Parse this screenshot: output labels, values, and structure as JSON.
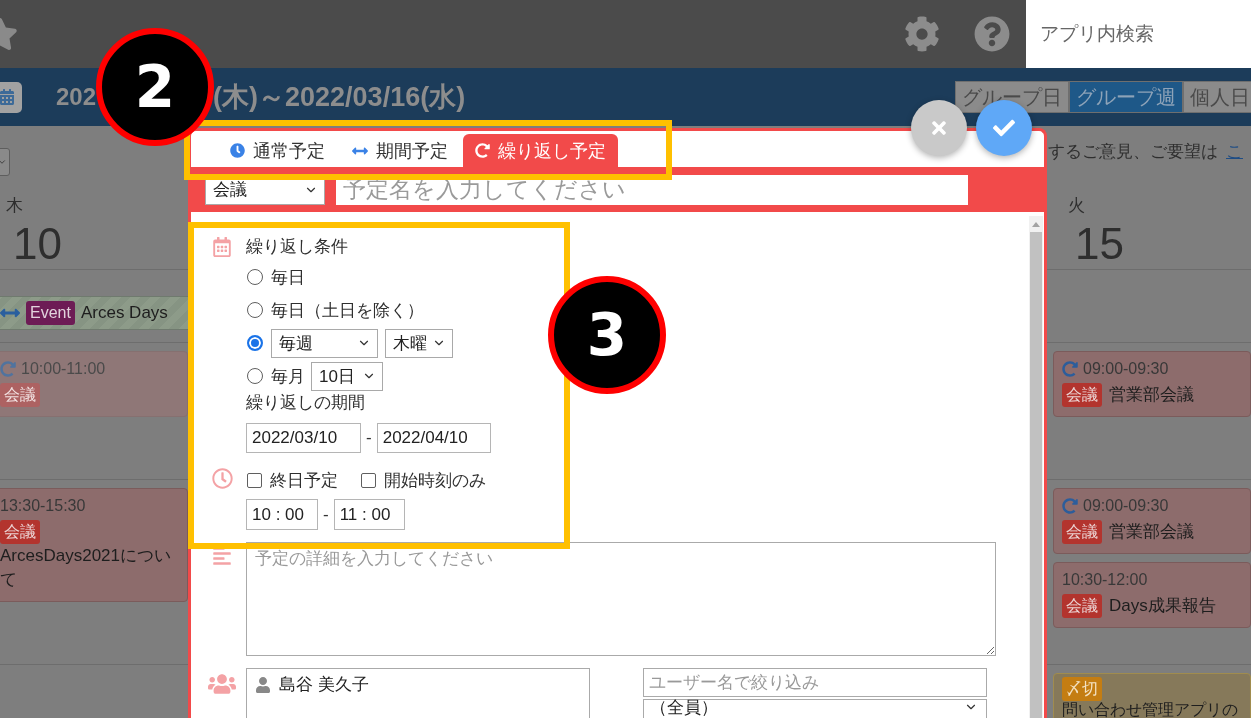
{
  "top_bar": {
    "search": {
      "placeholder": "アプリ内検索"
    }
  },
  "header": {
    "date_range_parts": [
      "202",
      "(木)～2022/03/16(水)"
    ],
    "view_tabs": [
      {
        "label": "グループ日",
        "selected": false
      },
      {
        "label": "グループ週",
        "selected": true
      },
      {
        "label": "個人日",
        "selected": false
      }
    ]
  },
  "calendar": {
    "notice": {
      "text": "するご意見、ご要望は",
      "link": "こ"
    },
    "days": [
      {
        "weekday": "木",
        "date": "10",
        "all_day": [
          {
            "kind": "period",
            "badge": "Event",
            "title": "Arces Days"
          }
        ],
        "blocks": [
          [
            {
              "kind": "meeting",
              "repeat": true,
              "faded": true,
              "time": "10:00-11:00",
              "badge": "会議"
            }
          ],
          [
            {
              "kind": "meeting",
              "repeat": false,
              "faded": false,
              "time": "13:30-15:30",
              "badge": "会議",
              "title": "ArcesDays2021について"
            }
          ]
        ]
      },
      {
        "weekday": "火",
        "date": "15",
        "blocks": [
          [
            {
              "kind": "meeting",
              "repeat": true,
              "faded": false,
              "time": "09:00-09:30",
              "badge": "会議",
              "title": "営業部会議"
            }
          ],
          [
            {
              "kind": "meeting",
              "repeat": true,
              "faded": false,
              "time": "09:00-09:30",
              "badge": "会議",
              "title": "営業部会議"
            },
            {
              "kind": "meeting",
              "repeat": false,
              "faded": false,
              "time": "10:30-12:00",
              "badge": "会議",
              "title": "Days成果報告"
            }
          ],
          [
            {
              "kind": "deadline",
              "badge": "〆切",
              "title": "問い合わせ管理アプリの"
            }
          ]
        ]
      }
    ]
  },
  "dialog": {
    "tabs": [
      {
        "kind": "single",
        "label": "通常予定",
        "selected": false
      },
      {
        "kind": "period",
        "label": "期間予定",
        "selected": false
      },
      {
        "kind": "repeat",
        "label": "繰り返し予定",
        "selected": true
      }
    ],
    "category": "会議",
    "title_placeholder": "予定名を入力してください",
    "repeat": {
      "label": "繰り返し条件",
      "options": [
        {
          "kind": "plain",
          "label": "毎日",
          "selected": false
        },
        {
          "kind": "plain",
          "label": "毎日（土日を除く）",
          "selected": false
        },
        {
          "kind": "weekly",
          "interval": "毎週",
          "weekday": "木曜",
          "selected": true
        },
        {
          "kind": "monthly",
          "label": "毎月",
          "day": "10日",
          "selected": false
        }
      ],
      "period_label": "繰り返しの期間",
      "start_date": "2022/03/10",
      "date_separator": "-",
      "end_date": "2022/04/10"
    },
    "time": {
      "options": [
        {
          "label": "終日予定",
          "checked": false
        },
        {
          "label": "開始時刻のみ",
          "checked": false
        }
      ],
      "start": "10 : 00",
      "separator": "-",
      "end": "11 : 00"
    },
    "detail_placeholder": "予定の詳細を入力してください",
    "participants": {
      "members": [
        "島谷 美久子"
      ],
      "filter_placeholder": "ユーザー名で絞り込み",
      "group": "（全員）"
    }
  },
  "dialog_actions": [
    {
      "kind": "cancel"
    },
    {
      "kind": "confirm"
    }
  ],
  "annotations": [
    {
      "label": "2"
    },
    {
      "label": "3"
    }
  ]
}
